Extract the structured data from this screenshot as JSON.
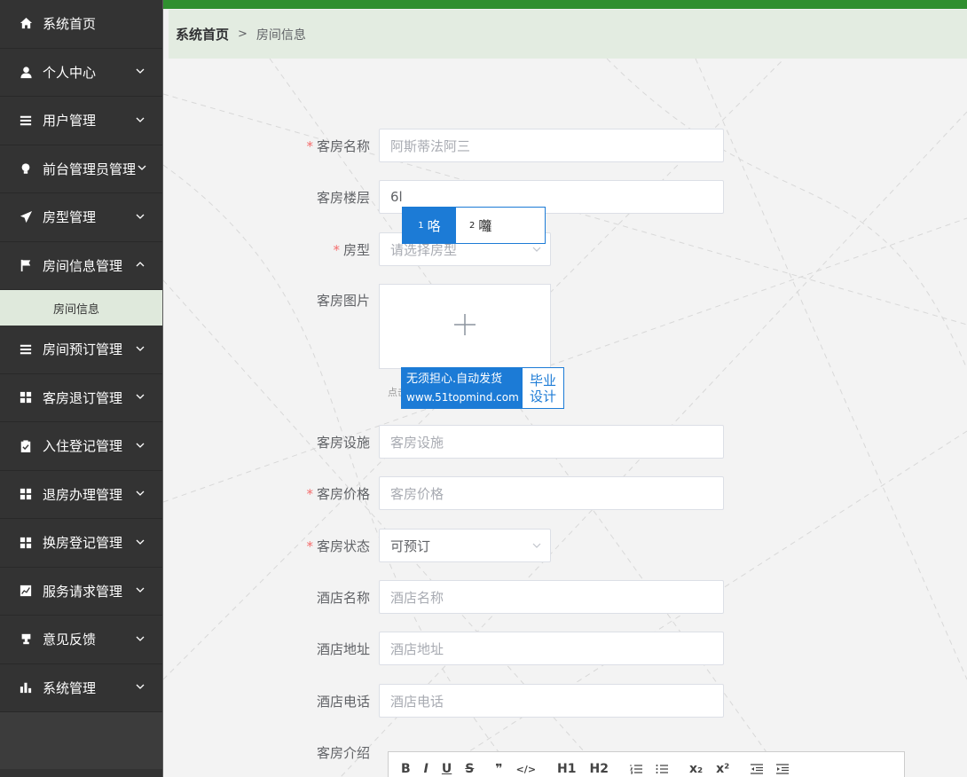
{
  "sidebar": {
    "items": [
      {
        "label": "系统首页",
        "icon": "home-icon"
      },
      {
        "label": "个人中心",
        "icon": "user-icon"
      },
      {
        "label": "用户管理",
        "icon": "list-icon"
      },
      {
        "label": "前台管理员管理",
        "icon": "bulb-icon"
      },
      {
        "label": "房型管理",
        "icon": "paper-plane-icon"
      },
      {
        "label": "房间信息管理",
        "icon": "flag-icon"
      },
      {
        "label": "房间预订管理",
        "icon": "list-icon"
      },
      {
        "label": "客房退订管理",
        "icon": "grid-icon"
      },
      {
        "label": "入住登记管理",
        "icon": "clipboard-check-icon"
      },
      {
        "label": "退房办理管理",
        "icon": "grid-icon"
      },
      {
        "label": "换房登记管理",
        "icon": "grid-icon"
      },
      {
        "label": "服务请求管理",
        "icon": "chart-line-icon"
      },
      {
        "label": "意见反馈",
        "icon": "trophy-icon"
      },
      {
        "label": "系统管理",
        "icon": "bar-chart-icon"
      }
    ],
    "submenu": {
      "label": "房间信息"
    }
  },
  "breadcrumb": {
    "home": "系统首页",
    "separator": ">",
    "current": "房间信息"
  },
  "form": {
    "room_name": {
      "label": "客房名称",
      "value": "阿斯蒂法阿三"
    },
    "floor": {
      "label": "客房楼层",
      "value": "6l"
    },
    "room_type": {
      "label": "房型",
      "placeholder": "请选择房型"
    },
    "image": {
      "label": "客房图片",
      "hint": "点击"
    },
    "facilities": {
      "label": "客房设施",
      "placeholder": "客房设施"
    },
    "price": {
      "label": "客房价格",
      "placeholder": "客房价格"
    },
    "status": {
      "label": "客房状态",
      "value": "可预订"
    },
    "hotel_name": {
      "label": "酒店名称",
      "placeholder": "酒店名称"
    },
    "hotel_address": {
      "label": "酒店地址",
      "placeholder": "酒店地址"
    },
    "hotel_phone": {
      "label": "酒店电话",
      "placeholder": "酒店电话"
    },
    "intro": {
      "label": "客房介绍"
    }
  },
  "ime": {
    "cand1_num": "1",
    "cand1": "咯",
    "cand2_num": "2",
    "cand2": "囖"
  },
  "watermark": {
    "line1": "无须担心.自动发货",
    "line2": "www.51topmind.com",
    "right1": "毕业",
    "right2": "设计"
  },
  "editor": {
    "tools": [
      "B",
      "I",
      "U",
      "S",
      "❞",
      "</>",
      "H1",
      "H2",
      "ol",
      "ul",
      "x₂",
      "x²",
      "outdent",
      "indent"
    ]
  },
  "colors": {
    "sidebar": "#333333",
    "accent_green": "#2f8f2f",
    "breadcrumb_bg": "#e3ece1",
    "ime_blue": "#1c7bd6",
    "required": "#f56c6c"
  }
}
